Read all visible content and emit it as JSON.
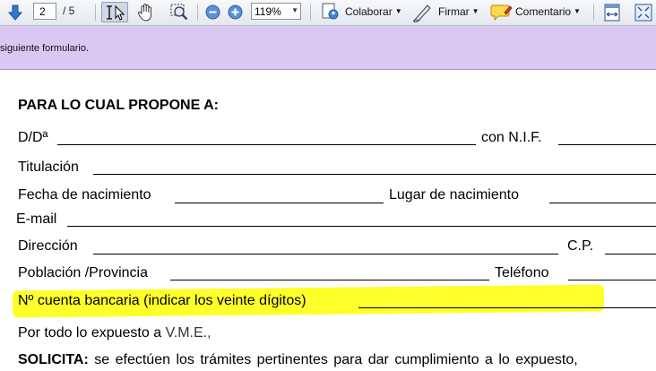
{
  "toolbar": {
    "page_current": "2",
    "page_total": "/ 5",
    "zoom": "119%",
    "colaborar_label": "Colaborar",
    "firmar_label": "Firmar",
    "comentario_label": "Comentario",
    "colors": {
      "accent": "#1f6fd1",
      "banner": "#dac8f2"
    }
  },
  "banner": {
    "text": "siguiente formulario."
  },
  "form": {
    "heading": "PARA LO CUAL PROPONE A:",
    "dd_label": "D/Dª",
    "nif_label": "con N.I.F.",
    "titulacion_label": "Titulación",
    "fecha_label": "Fecha de nacimiento",
    "lugar_label": "Lugar de nacimiento",
    "email_label": "E-mail",
    "direccion_label": "Dirección",
    "cp_label": "C.P.",
    "poblacion_label": "Población /Provincia",
    "telefono_label": "Teléfono",
    "cuenta_label": "Nº cuenta bancaria (indicar los veinte dígitos)",
    "expuesto_prefix": "Por todo lo expuesto a ",
    "expuesto_name": "V.M.E.,",
    "solicita_label": "SOLICITA:",
    "solicita_text": "se efectúen los trámites pertinentes para dar cumplimiento a lo expuesto,"
  }
}
